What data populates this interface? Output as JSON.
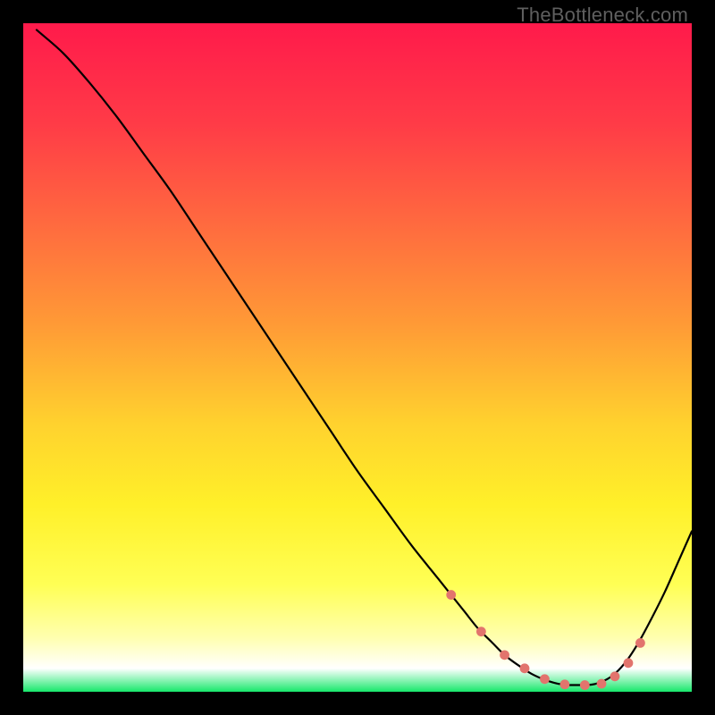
{
  "watermark": "TheBottleneck.com",
  "chart_data": {
    "type": "line",
    "title": "",
    "xlabel": "",
    "ylabel": "",
    "xlim": [
      0,
      100
    ],
    "ylim": [
      0,
      100
    ],
    "background_gradient": {
      "stops": [
        {
          "offset": 0.0,
          "color": "#ff1a4b"
        },
        {
          "offset": 0.15,
          "color": "#ff3b47"
        },
        {
          "offset": 0.3,
          "color": "#ff6a3f"
        },
        {
          "offset": 0.45,
          "color": "#ff9a36"
        },
        {
          "offset": 0.6,
          "color": "#ffd22e"
        },
        {
          "offset": 0.72,
          "color": "#fff029"
        },
        {
          "offset": 0.84,
          "color": "#ffff55"
        },
        {
          "offset": 0.92,
          "color": "#ffffb0"
        },
        {
          "offset": 0.965,
          "color": "#ffffff"
        },
        {
          "offset": 1.0,
          "color": "#17e86b"
        }
      ]
    },
    "series": [
      {
        "name": "bottleneck-curve",
        "color": "#000000",
        "x": [
          2,
          6,
          10,
          14,
          18,
          22,
          26,
          30,
          34,
          38,
          42,
          46,
          50,
          54,
          58,
          62,
          64,
          66,
          68,
          70,
          72,
          74,
          76,
          78,
          80,
          82,
          84,
          86,
          88,
          90,
          92,
          94,
          96,
          98,
          100
        ],
        "y": [
          99,
          95.5,
          91,
          86,
          80.5,
          75,
          69,
          63,
          57,
          51,
          45,
          39,
          33,
          27.5,
          22,
          17,
          14.5,
          12,
          9.5,
          7.5,
          5.5,
          4,
          2.7,
          1.8,
          1.2,
          1,
          1,
          1.3,
          2.3,
          4.3,
          7.3,
          11,
          15,
          19.5,
          24
        ]
      }
    ],
    "markers": {
      "name": "optimal-range-dots",
      "color": "#e2746d",
      "radius": 5.4,
      "x": [
        64,
        68.5,
        72,
        75,
        78,
        81,
        84,
        86.5,
        88.5,
        90.5,
        92.3
      ],
      "y": [
        14.5,
        9.0,
        5.5,
        3.5,
        1.9,
        1.1,
        1.0,
        1.2,
        2.3,
        4.3,
        7.3
      ]
    }
  }
}
